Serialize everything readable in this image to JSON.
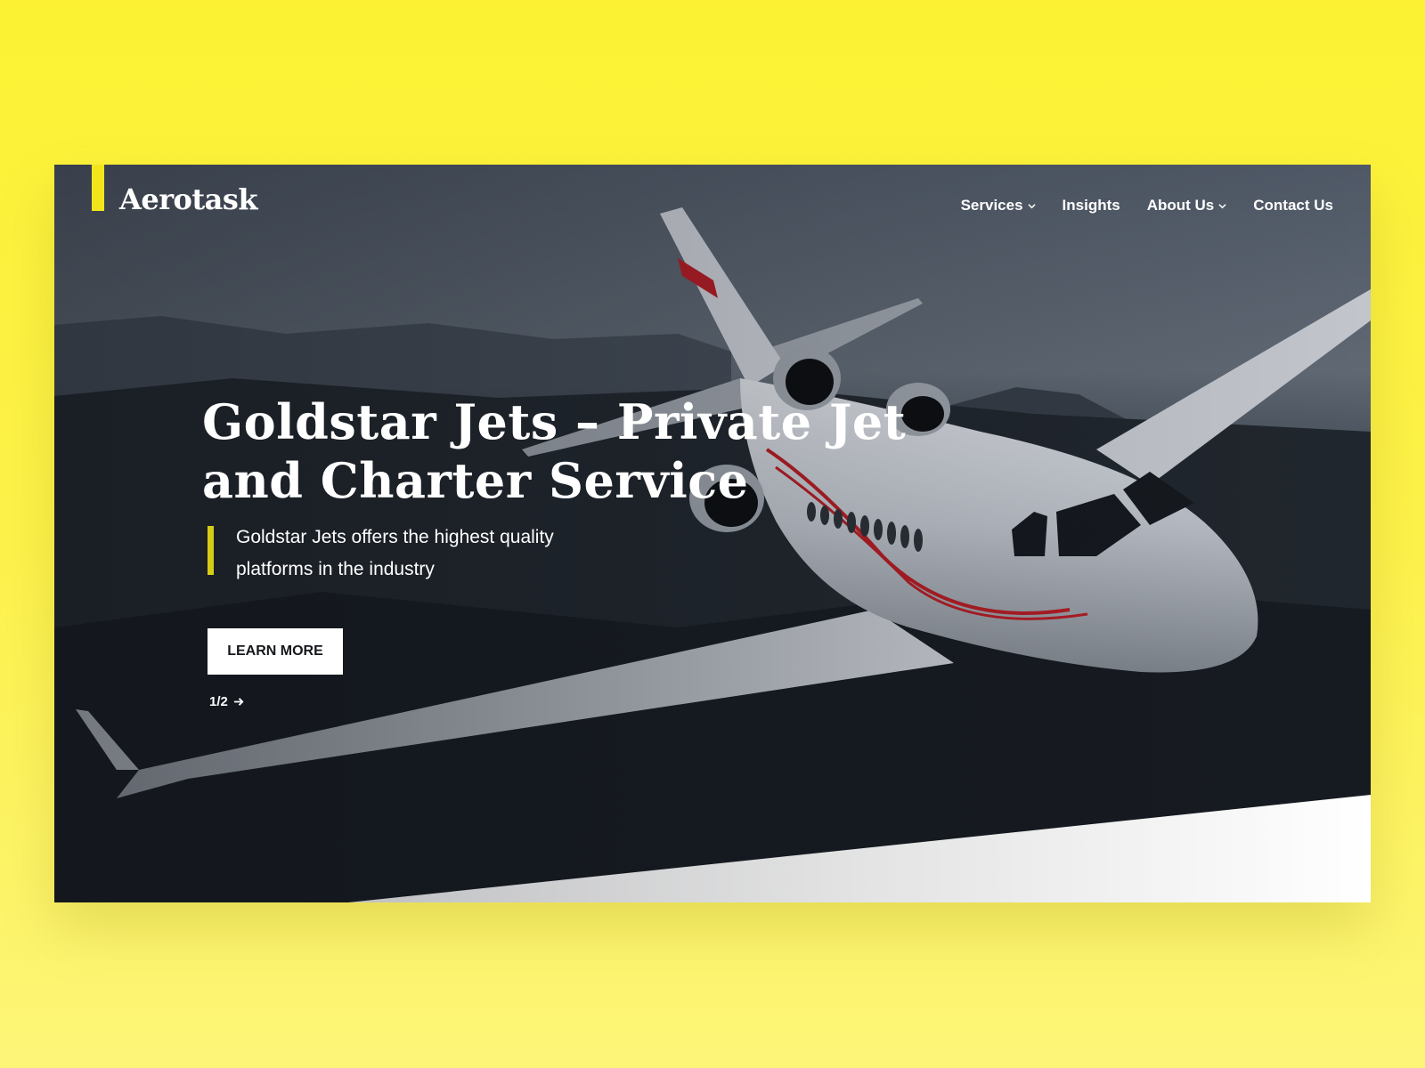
{
  "brand": {
    "name": "Aerotask",
    "accent_color": "#f2e51c"
  },
  "nav": {
    "items": [
      {
        "label": "Services",
        "has_dropdown": true,
        "icon": "chevron-down-icon"
      },
      {
        "label": "Insights",
        "has_dropdown": false
      },
      {
        "label": "About Us",
        "has_dropdown": true,
        "icon": "chevron-down-icon"
      },
      {
        "label": "Contact Us",
        "has_dropdown": false
      }
    ]
  },
  "hero": {
    "title": "Goldstar Jets – Private Jet and Charter Service",
    "subtitle": "Goldstar Jets offers the highest quality platforms in the industry",
    "cta_label": "LEARN MORE",
    "pager": "1/2",
    "pager_icon": "arrow-right-icon",
    "background": "private-jet-over-mountains-photo"
  },
  "colors": {
    "page_background": "#fcf233",
    "text": "#ffffff",
    "button_bg": "#ffffff"
  }
}
